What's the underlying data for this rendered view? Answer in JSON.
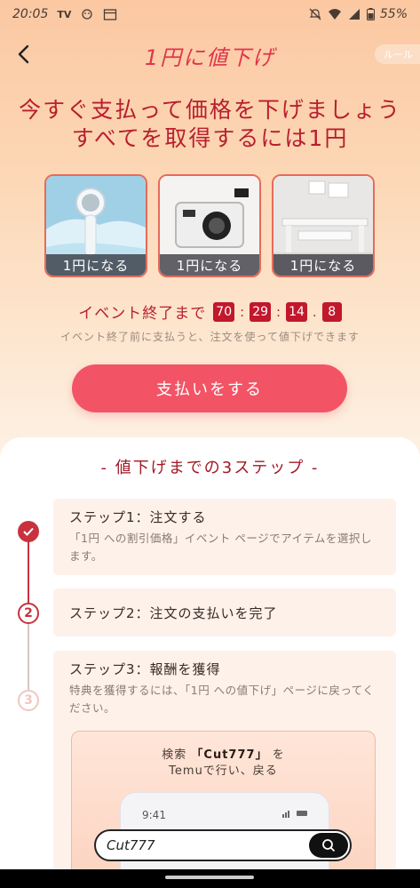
{
  "status": {
    "time": "20:05",
    "battery": "55%"
  },
  "nav": {
    "title": "1円に値下げ",
    "rules": "ルール"
  },
  "headline": {
    "line1": "今すぐ支払って価格を下げましょう",
    "line2": "すべてを取得するには1円"
  },
  "products": [
    {
      "label": "1円になる",
      "icon": "handheld-fan-image"
    },
    {
      "label": "1円になる",
      "icon": "digital-camera-image"
    },
    {
      "label": "1円になる",
      "icon": "desk-shelf-image"
    }
  ],
  "timer": {
    "label": "イベント終了まで",
    "hours": "70",
    "minutes": "29",
    "seconds": "14",
    "tenths": "8",
    "sep": ":",
    "dot": "."
  },
  "subnote": "イベント終了前に支払うと、注文を使って値下げできます",
  "pay_button": "支払いをする",
  "steps_title": "- 値下げまでの3ステップ -",
  "steps": [
    {
      "num": "1",
      "title": "ステップ1：注文する",
      "desc": "「1円 への割引価格」イベント ページでアイテムを選択します。"
    },
    {
      "num": "2",
      "title": "ステップ2：注文の支払いを完了",
      "desc": ""
    },
    {
      "num": "3",
      "title": "ステップ3：報酬を獲得",
      "desc": "特典を獲得するには、「1円 への値下げ」ページに戻ってください。"
    }
  ],
  "inner_card": {
    "text_before": "検索",
    "quoted": "「Cut777」",
    "text_after": "を",
    "line2": "Temuで行い、戻る",
    "phone_time": "9:41"
  },
  "search": {
    "value": "Cut777"
  },
  "colors": {
    "accent": "#f25466",
    "title_red": "#e0344e",
    "dark_red": "#b81f2e"
  }
}
